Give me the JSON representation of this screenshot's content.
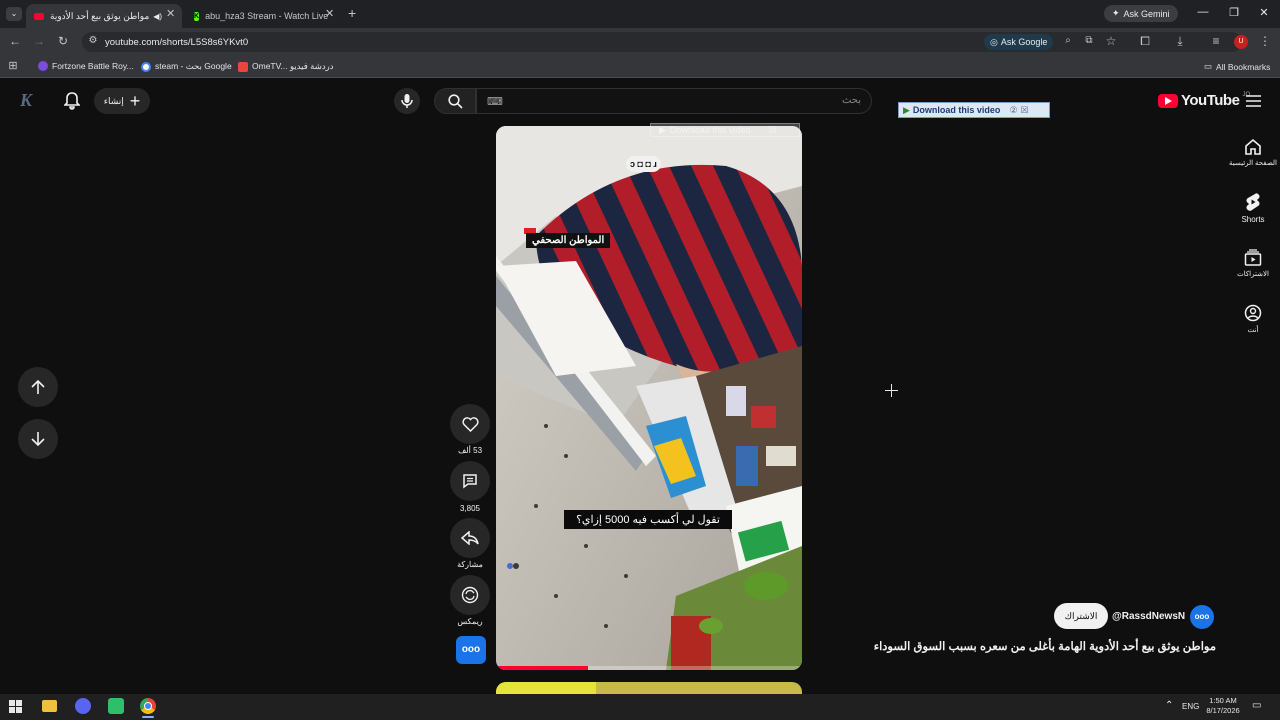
{
  "browser": {
    "tabs": [
      {
        "title": "مواطن يوثق بيع أحد الأدوية",
        "active": true
      },
      {
        "title": "abu_hza3 Stream - Watch Live",
        "active": false
      }
    ],
    "new_tab": "+",
    "ask_gemini": "Ask Gemini",
    "url": "youtube.com/shorts/L5S8s6YKvt0",
    "ask_google": "Ask Google",
    "bookmarks": [
      "Fortzone Battle Roy...",
      "steam - بحث Google",
      "OmeTV... دردشة فيديو"
    ],
    "all_bookmarks": "All Bookmarks",
    "profile_initial": "U"
  },
  "youtube": {
    "logo_text": "YouTube",
    "logo_sup": "JO",
    "create_label": "إنشاء",
    "search_placeholder": "بحث",
    "download_banner": "Download this video",
    "download_overlay": "Download this video",
    "nav": [
      {
        "label": "الصفحة الرئيسية",
        "icon": "home-icon"
      },
      {
        "label": "Shorts",
        "icon": "shorts-icon"
      },
      {
        "label": "الاشتراكات",
        "icon": "subscriptions-icon"
      },
      {
        "label": "أنت",
        "icon": "you-icon"
      }
    ]
  },
  "short": {
    "overlay_name": "المواطن الصحفي",
    "subtitle": "تقول لي أكسب فيه 5000 إزاي؟",
    "watermark": "ɔ ◘ ◘ ɹ",
    "progress": 0.3,
    "likes": "53 ألف",
    "comments": "3,805",
    "share_label": "مشاركة",
    "remix_label": "ريمكس",
    "channel_badge": "ooo",
    "channel_handle": "@RassdNewsN",
    "subscribe_label": "الاشتراك",
    "title": "مواطن يوثق بيع أحد الأدوية الهامة بأغلى من سعره بسبب السوق السوداء"
  },
  "taskbar": {
    "lang": "ENG",
    "time": "1:50 AM",
    "date": "8/17/2026"
  },
  "colors": {
    "accent_red": "#ff0033",
    "badge_blue": "#1a73e8",
    "background": "#0f0f0f"
  }
}
